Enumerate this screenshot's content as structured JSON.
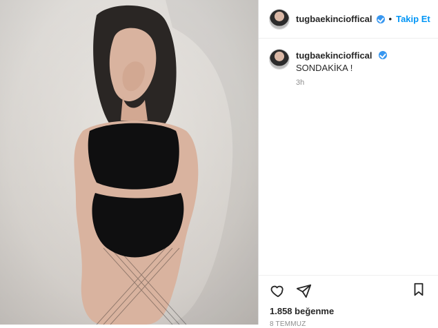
{
  "post": {
    "author": {
      "username": "tugbaekincioffical",
      "verified": true
    },
    "header": {
      "separator": "•",
      "follow_label": "Takip Et"
    },
    "caption": {
      "username": "tugbaekincioffical",
      "text": "SONDAKİKA !",
      "time": "3h"
    },
    "stats": {
      "likes_text": "1.858 beğenme"
    },
    "date_text": "8 TEMMUZ"
  },
  "icons": {
    "like": "heart-icon",
    "share": "paper-plane-icon",
    "save": "bookmark-icon",
    "verified": "verified-badge-icon"
  },
  "colors": {
    "follow_blue": "#0095f6",
    "verified_blue": "#3897f0",
    "border": "#dbdbdb",
    "text": "#262626",
    "muted": "#8e8e8e"
  }
}
